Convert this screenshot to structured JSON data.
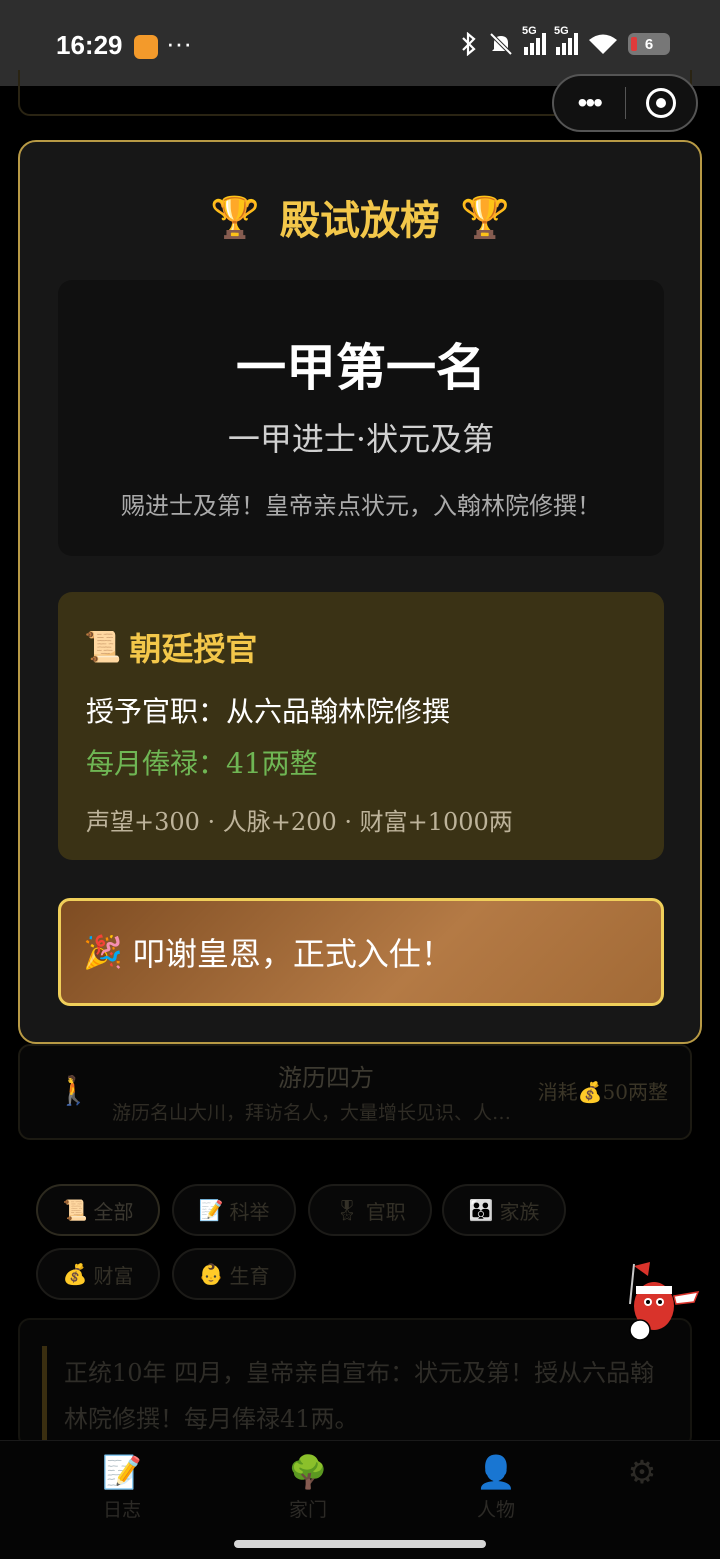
{
  "status_bar": {
    "time": "16:29",
    "dots": "···",
    "network1": "5G",
    "network2": "5G",
    "battery": "6"
  },
  "capsule": {
    "more_label": "•••"
  },
  "modal": {
    "title": "殿试放榜",
    "trophy_glyph": "🏆",
    "rank_main": "一甲第一名",
    "rank_sub": "一甲进士·状元及第",
    "rank_desc": "赐进士及第！皇帝亲点状元，入翰林院修撰！",
    "office": {
      "icon_glyph": "📜",
      "title": "朝廷授官",
      "line1": "授予官职：从六品翰林院修撰",
      "line2": "每月俸禄：41两整",
      "line3": "声望+300 · 人脉+200 · 财富+1000两"
    },
    "confirm": {
      "icon_glyph": "🎉",
      "label": "叩谢皇恩，正式入仕！"
    }
  },
  "background": {
    "travel": {
      "icon_glyph": "🚶",
      "title": "游历四方",
      "desc": "游历名山大川，拜访名人，大量增长见识、人…",
      "cost": "消耗💰50两整"
    },
    "chips": [
      {
        "icon": "📜",
        "label": "全部"
      },
      {
        "icon": "📝",
        "label": "科举"
      },
      {
        "icon": "🎖",
        "label": "官职"
      },
      {
        "icon": "👪",
        "label": "家族"
      },
      {
        "icon": "💰",
        "label": "财富"
      },
      {
        "icon": "👶",
        "label": "生育"
      }
    ],
    "log_text": "正统10年 四月，皇帝亲自宣布：状元及第！授从六品翰林院修撰！每月俸禄41两。",
    "tabs": [
      {
        "icon": "📝",
        "label": "日志"
      },
      {
        "icon": "🌳",
        "label": "家门"
      },
      {
        "icon": "👤",
        "label": "人物"
      },
      {
        "icon": "⚙",
        "label": ""
      }
    ]
  }
}
